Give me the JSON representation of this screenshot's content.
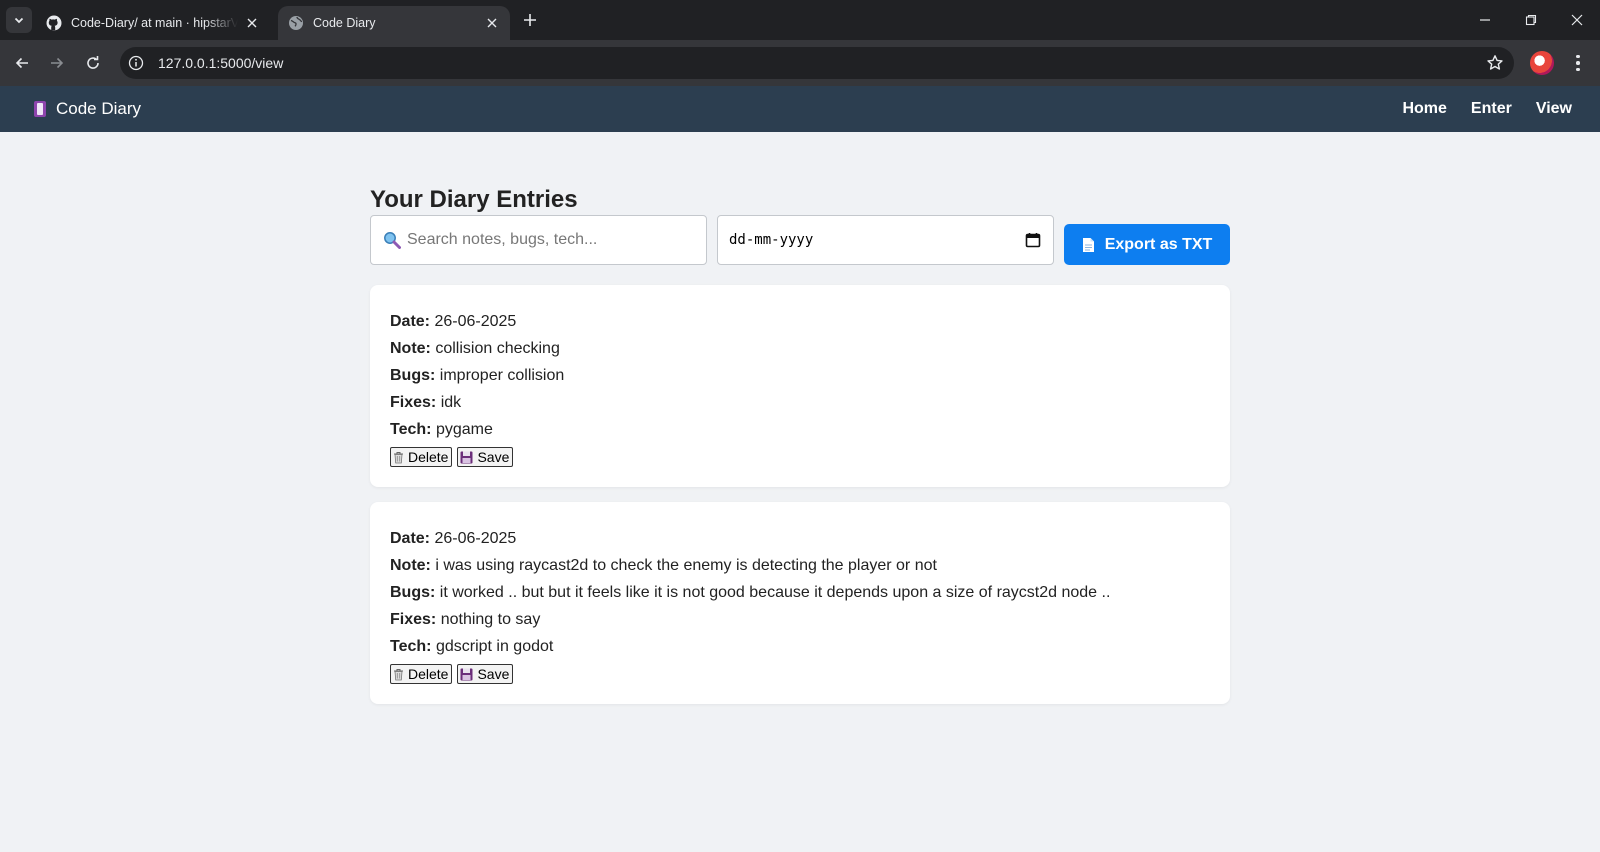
{
  "browser": {
    "tabs": [
      {
        "title": "Code-Diary/ at main · hipstarVe",
        "icon": "github-icon",
        "active": false
      },
      {
        "title": "Code Diary",
        "icon": "globe-icon",
        "active": true
      }
    ],
    "url": "127.0.0.1:5000/view"
  },
  "navbar": {
    "brand": "Code Diary",
    "brand_icon": "notebook-icon",
    "links": [
      "Home",
      "Enter",
      "View"
    ]
  },
  "page": {
    "title": "Your Diary Entries",
    "search_placeholder": "Search notes, bugs, tech...",
    "date_placeholder": "dd-mm-yyyy",
    "export_label": "Export as TXT",
    "accent_color": "#0d7ef0",
    "navbar_color": "#2c3e50"
  },
  "labels": {
    "date": "Date:",
    "note": "Note:",
    "bugs": "Bugs:",
    "fixes": "Fixes:",
    "tech": "Tech:",
    "delete": "Delete",
    "save": "Save"
  },
  "entries": [
    {
      "date": "26-06-2025",
      "note": "collision checking",
      "bugs": "improper collision",
      "fixes": "idk",
      "tech": "pygame"
    },
    {
      "date": "26-06-2025",
      "note": "i was using raycast2d to check the enemy is detecting the player or not",
      "bugs": "it worked .. but but it feels like it is not good because it depends upon a size of raycst2d node ..",
      "fixes": "nothing to say",
      "tech": "gdscript in godot"
    }
  ]
}
